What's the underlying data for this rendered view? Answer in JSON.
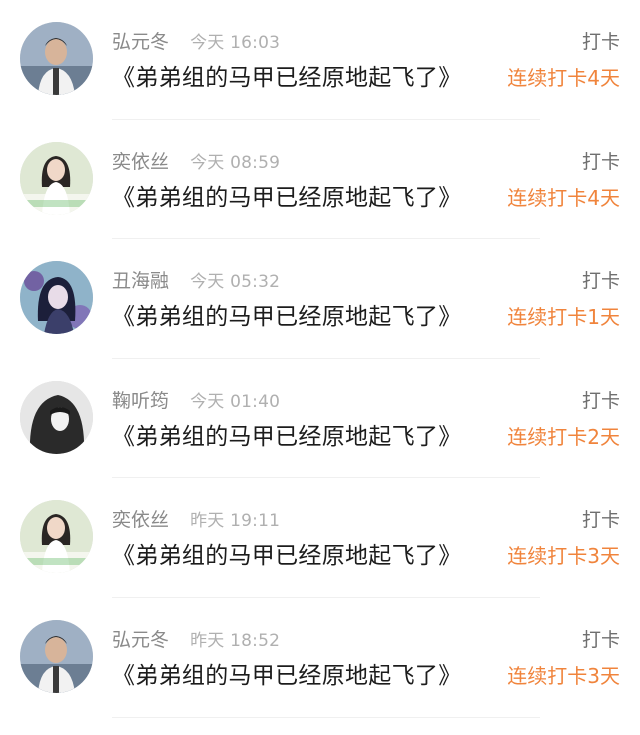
{
  "items": [
    {
      "avatar_icon": "male-portrait-avatar",
      "name": "弘元冬",
      "time": "今天 16:03",
      "action_label": "打卡",
      "title": "《弟弟组的马甲已经原地起飞了》",
      "streak": "连续打卡4天"
    },
    {
      "avatar_icon": "female-portrait-avatar",
      "name": "奕依丝",
      "time": "今天 08:59",
      "action_label": "打卡",
      "title": "《弟弟组的马甲已经原地起飞了》",
      "streak": "连续打卡4天"
    },
    {
      "avatar_icon": "anime-girl-avatar",
      "name": "丑海融",
      "time": "今天 05:32",
      "action_label": "打卡",
      "title": "《弟弟组的马甲已经原地起飞了》",
      "streak": "连续打卡1天"
    },
    {
      "avatar_icon": "hooded-figure-avatar",
      "name": "鞠听筠",
      "time": "今天 01:40",
      "action_label": "打卡",
      "title": "《弟弟组的马甲已经原地起飞了》",
      "streak": "连续打卡2天"
    },
    {
      "avatar_icon": "female-portrait-avatar",
      "name": "奕依丝",
      "time": "昨天 19:11",
      "action_label": "打卡",
      "title": "《弟弟组的马甲已经原地起飞了》",
      "streak": "连续打卡3天"
    },
    {
      "avatar_icon": "male-portrait-avatar",
      "name": "弘元冬",
      "time": "昨天 18:52",
      "action_label": "打卡",
      "title": "《弟弟组的马甲已经原地起飞了》",
      "streak": "连续打卡3天"
    }
  ],
  "colors": {
    "accent_streak": "#f0843c",
    "name_text": "#8a8a8a",
    "time_text": "#b0b0b0",
    "title_text": "#1c1c1c"
  }
}
